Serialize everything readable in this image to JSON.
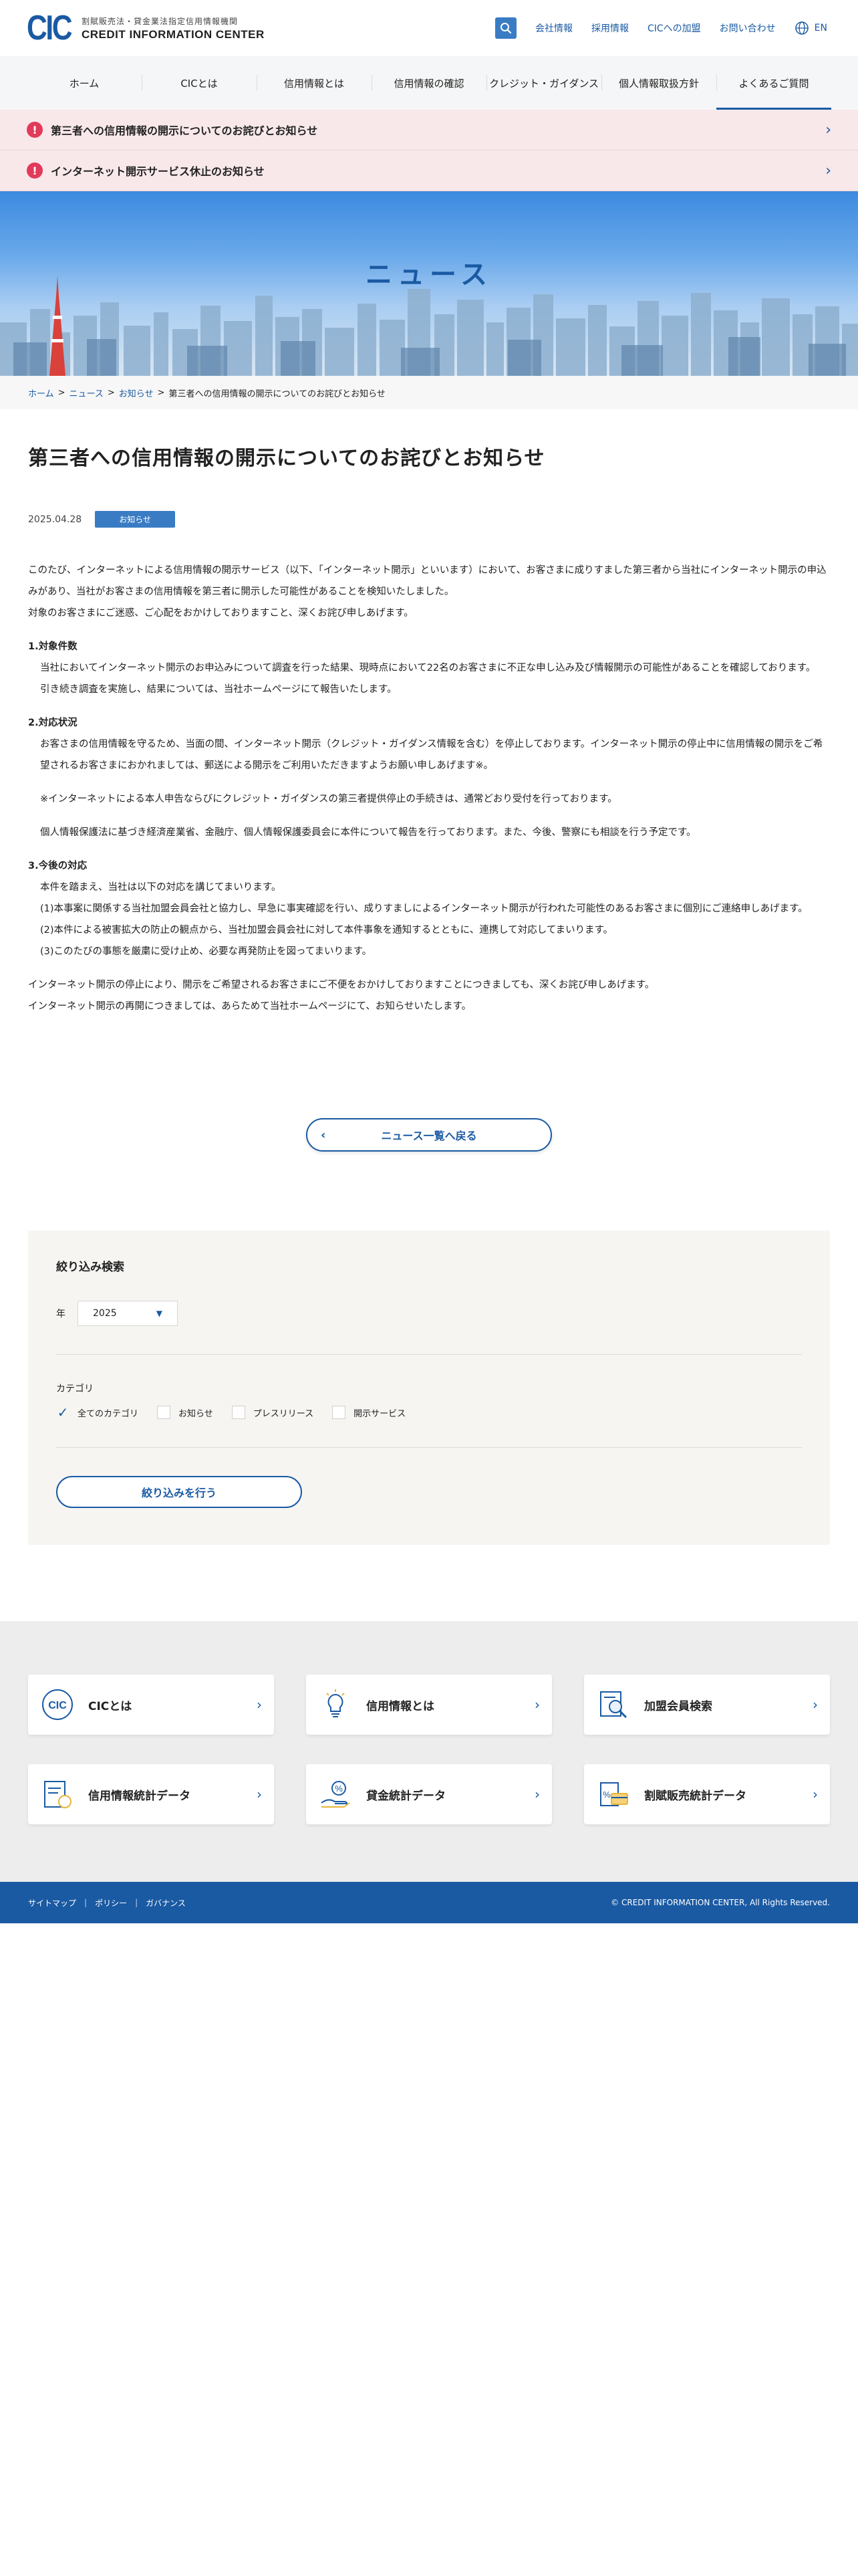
{
  "header": {
    "logo_mark": "CIC",
    "logo_sub": "割賦販売法・貸金業法指定信用情報機関",
    "logo_main": "CREDIT INFORMATION CENTER",
    "util_links": [
      "会社情報",
      "採用情報",
      "CICへの加盟",
      "お問い合わせ"
    ],
    "lang": "EN"
  },
  "gnav": [
    "ホーム",
    "CICとは",
    "信用情報とは",
    "信用情報の確認",
    "クレジット・ガイダンス",
    "個人情報取扱方針",
    "よくあるご質問"
  ],
  "alerts": [
    {
      "text": "第三者への信用情報の開示についてのお詫びとお知らせ"
    },
    {
      "text": "インターネット開示サービス休止のお知らせ"
    }
  ],
  "hero": {
    "title": "ニュース"
  },
  "breadcrumb": {
    "home": "ホーム",
    "news": "ニュース",
    "notice": "お知らせ",
    "current": "第三者への信用情報の開示についてのお詫びとお知らせ"
  },
  "article": {
    "title": "第三者への信用情報の開示についてのお詫びとお知らせ",
    "date": "2025.04.28",
    "tag": "お知らせ",
    "intro1": "このたび、インターネットによる信用情報の開示サービス（以下、「インターネット開示」といいます）において、お客さまに成りすました第三者から当社にインターネット開示の申込みがあり、当社がお客さまの信用情報を第三者に開示した可能性があることを検知いたしました。",
    "intro2": "対象のお客さまにご迷惑、ご心配をおかけしておりますこと、深くお詫び申しあげます。",
    "s1_title": "1.対象件数",
    "s1_p1": "当社においてインターネット開示のお申込みについて調査を行った結果、現時点において22名のお客さまに不正な申し込み及び情報開示の可能性があることを確認しております。",
    "s1_p2": "引き続き調査を実施し、結果については、当社ホームページにて報告いたします。",
    "s2_title": "2.対応状況",
    "s2_p1": "お客さまの信用情報を守るため、当面の間、インターネット開示（クレジット・ガイダンス情報を含む）を停止しております。インターネット開示の停止中に信用情報の開示をご希望されるお客さまにおかれましては、郵送による開示をご利用いただきますようお願い申しあげます※。",
    "s2_note": "※インターネットによる本人申告ならびにクレジット・ガイダンスの第三者提供停止の手続きは、通常どおり受付を行っております。",
    "s2_p2": "個人情報保護法に基づき経済産業省、金融庁、個人情報保護委員会に本件について報告を行っております。また、今後、警察にも相談を行う予定です。",
    "s3_title": "3.今後の対応",
    "s3_p0": "本件を踏まえ、当社は以下の対応を講じてまいります。",
    "s3_i1": "(1)本事案に関係する当社加盟会員会社と協力し、早急に事実確認を行い、成りすましによるインターネット開示が行われた可能性のあるお客さまに個別にご連絡申しあげます。",
    "s3_i2": "(2)本件による被害拡大の防止の観点から、当社加盟会員会社に対して本件事象を通知するとともに、連携して対応してまいります。",
    "s3_i3": "(3)このたびの事態を厳粛に受け止め、必要な再発防止を図ってまいります。",
    "outro1": "インターネット開示の停止により、開示をご希望されるお客さまにご不便をおかけしておりますことにつきましても、深くお詫び申しあげます。",
    "outro2": "インターネット開示の再開につきましては、あらためて当社ホームページにて、お知らせいたします。"
  },
  "back_button": "ニュース一覧へ戻る",
  "filter": {
    "title": "絞り込み検索",
    "year_label": "年",
    "year_value": "2025",
    "category_label": "カテゴリ",
    "categories": [
      "全てのカテゴリ",
      "お知らせ",
      "プレスリリース",
      "開示サービス"
    ],
    "checked_index": 0,
    "submit": "絞り込みを行う"
  },
  "footer_cards": [
    {
      "label": "CICとは",
      "icon": "cic-logo-icon"
    },
    {
      "label": "信用情報とは",
      "icon": "lightbulb-icon"
    },
    {
      "label": "加盟会員検索",
      "icon": "member-search-icon"
    },
    {
      "label": "信用情報統計データ",
      "icon": "credit-statistics-icon"
    },
    {
      "label": "貸金統計データ",
      "icon": "loan-statistics-icon"
    },
    {
      "label": "割賦販売統計データ",
      "icon": "installment-statistics-icon"
    }
  ],
  "bottom": {
    "links": [
      "サイトマップ",
      "ポリシー",
      "ガバナンス"
    ],
    "copyright": "© CREDIT INFORMATION CENTER, All Rights Reserved."
  },
  "colors": {
    "brand": "#1a5aa3",
    "accent": "#3a7cc3",
    "alert_bg": "#f8e8ea",
    "alert_icon": "#e23a5b"
  }
}
